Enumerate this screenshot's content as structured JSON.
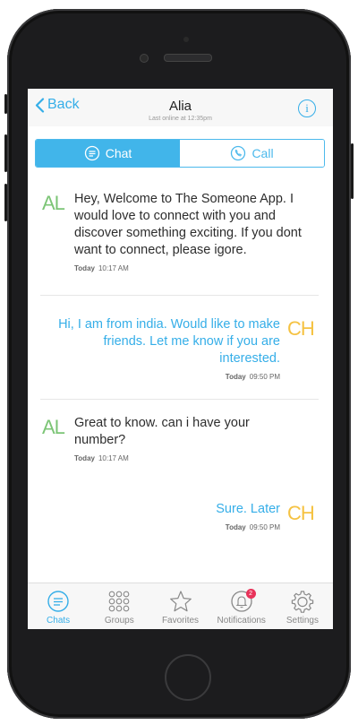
{
  "header": {
    "back_label": "Back",
    "title": "Alia",
    "subtitle": "Last online at 12:35pm"
  },
  "segments": [
    {
      "label": "Chat",
      "active": true
    },
    {
      "label": "Call",
      "active": false
    }
  ],
  "messages": [
    {
      "direction": "incoming",
      "initials": "AL",
      "text": "Hey, Welcome to The Someone App. I would love to connect with you and discover something exciting. If you dont want to connect, please igore.",
      "day": "Today",
      "time": "10:17 AM"
    },
    {
      "direction": "outgoing",
      "initials": "CH",
      "text": "Hi, I am from india. Would like to make friends. Let me know if you are interested.",
      "day": "Today",
      "time": "09:50 PM"
    },
    {
      "direction": "incoming",
      "initials": "AL",
      "text": "Great to know. can i have your number?",
      "day": "Today",
      "time": "10:17 AM"
    },
    {
      "direction": "outgoing",
      "initials": "CH",
      "text": "Sure. Later",
      "day": "Today",
      "time": "09:50 PM"
    }
  ],
  "tabbar": {
    "chats": "Chats",
    "groups": "Groups",
    "favorites": "Favorites",
    "notifications": "Notifications",
    "notifications_badge": "2",
    "settings": "Settings"
  },
  "colors": {
    "accent": "#35aee8",
    "incoming_initials": "#7cc576",
    "outgoing_initials": "#f5c242",
    "badge": "#e8335a"
  }
}
